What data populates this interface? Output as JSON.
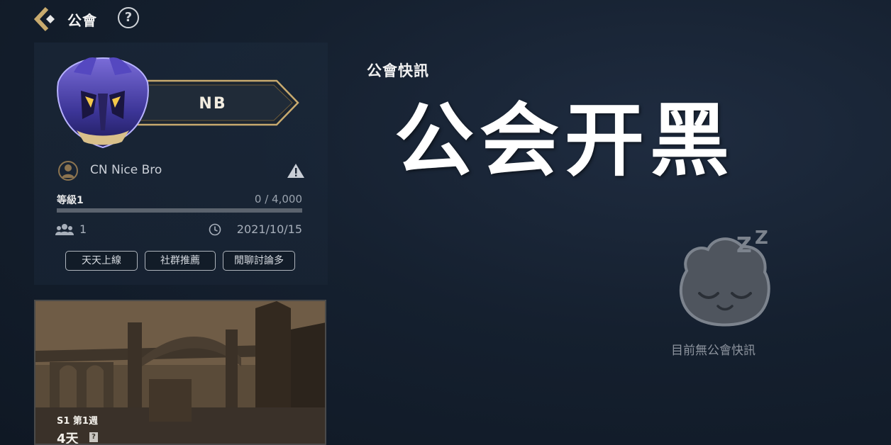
{
  "header": {
    "title": "公會"
  },
  "guild": {
    "name": "NB",
    "owner": "CN Nice Bro",
    "level_label": "等級1",
    "xp_text": "0 / 4,000",
    "xp_progress": 0,
    "members": "1",
    "created": "2021/10/15",
    "tags": [
      "天天上線",
      "社群推薦",
      "閒聊討論多"
    ]
  },
  "season": {
    "week": "S1 第1週",
    "days": "4天"
  },
  "news": {
    "heading": "公會快訊",
    "overlay_caption": "公会开黑",
    "empty_text": "目前無公會快訊"
  },
  "colors": {
    "accent_gold": "#c8aa6e",
    "background": "#15202f"
  }
}
